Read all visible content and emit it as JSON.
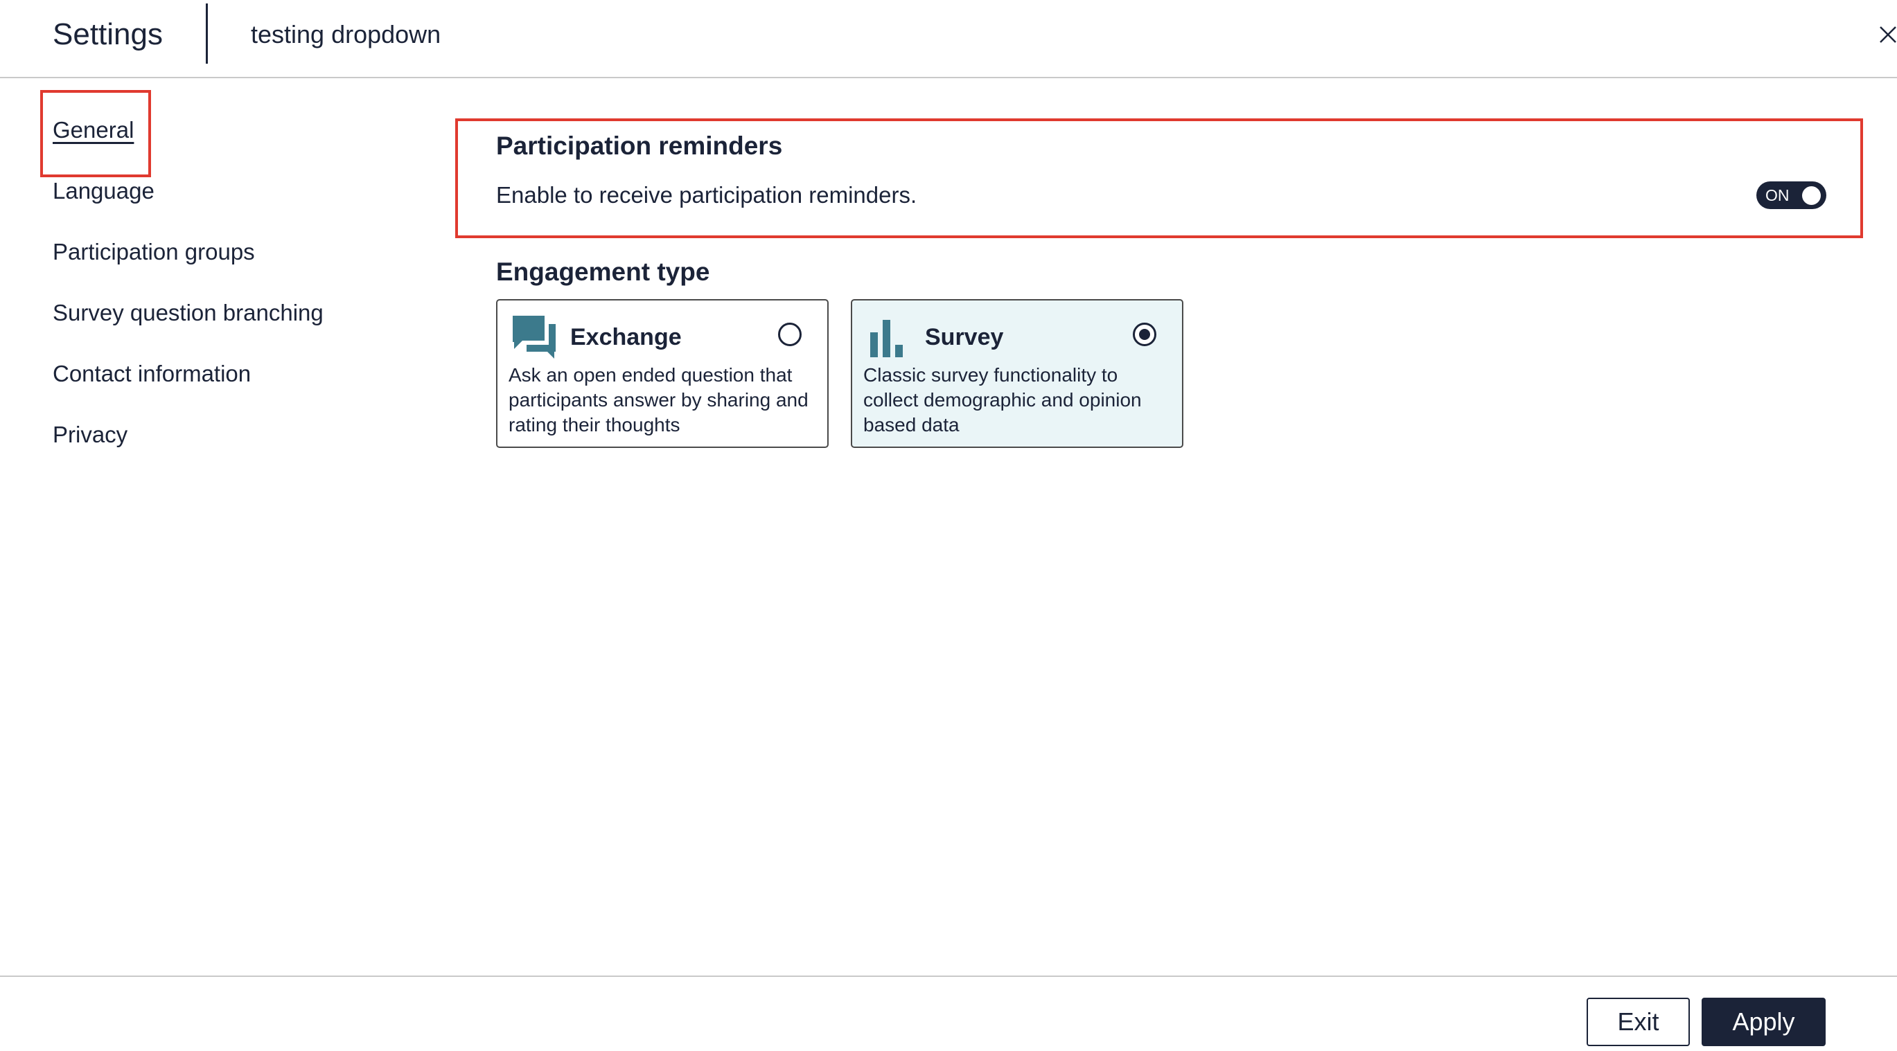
{
  "header": {
    "title": "Settings",
    "project_name": "testing dropdown"
  },
  "sidebar": {
    "items": [
      {
        "label": "General",
        "active": true
      },
      {
        "label": "Language"
      },
      {
        "label": "Participation groups"
      },
      {
        "label": "Survey question branching"
      },
      {
        "label": "Contact information"
      },
      {
        "label": "Privacy"
      }
    ]
  },
  "reminders": {
    "title": "Participation reminders",
    "description": "Enable to receive participation reminders.",
    "toggle_label": "ON",
    "toggle_on": true
  },
  "engagement": {
    "title": "Engagement type",
    "options": [
      {
        "title": "Exchange",
        "description": "Ask an open ended question that participants answer by sharing and rating their thoughts",
        "selected": false,
        "icon": "chat-bubbles-icon"
      },
      {
        "title": "Survey",
        "description": "Classic survey functionality to collect demographic and opinion based data",
        "selected": true,
        "icon": "bar-chart-icon"
      }
    ]
  },
  "footer": {
    "exit_label": "Exit",
    "apply_label": "Apply"
  },
  "colors": {
    "primary": "#1b2338",
    "icon_teal": "#3c7a8c",
    "highlight": "#e03a2f",
    "selected_card_bg": "#eaf5f7"
  }
}
